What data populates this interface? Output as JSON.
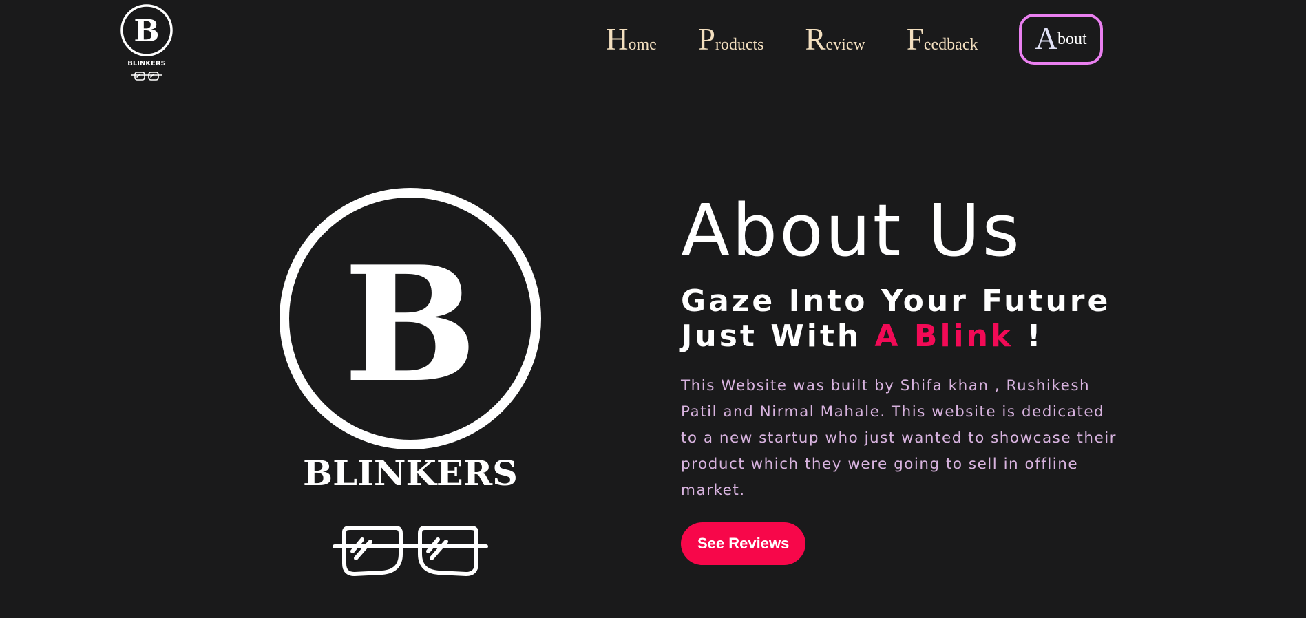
{
  "brand": {
    "name": "BLINKERS",
    "mark": "B"
  },
  "nav": {
    "items": [
      {
        "cap": "H",
        "rest": "ome"
      },
      {
        "cap": "P",
        "rest": "roducts"
      },
      {
        "cap": "R",
        "rest": "eview"
      },
      {
        "cap": "F",
        "rest": "eedback"
      },
      {
        "cap": "A",
        "rest": "bout"
      }
    ],
    "active": "About"
  },
  "hero": {
    "title": "About Us",
    "tagline_line1": "Gaze Into Your Future",
    "tagline_line2_prefix": "Just With ",
    "tagline_highlight": "A Blink",
    "tagline_suffix": " !",
    "description": "This Website was built by Shifa khan , Rushikesh Patil and Nirmal Mahale. This website is dedicated to a new startup who just wanted to showcase their product which they were going to sell in offline market.",
    "button_label": "See Reviews"
  },
  "colors": {
    "background": "#1a1a1b",
    "nav_text": "#f3dfbf",
    "active_border": "#ea80f0",
    "accent": "#f20a56",
    "description_text": "#d8b3df",
    "button_bg": "#f7074a"
  },
  "icons": [
    "blinkers-logo",
    "sunglasses-icon"
  ]
}
